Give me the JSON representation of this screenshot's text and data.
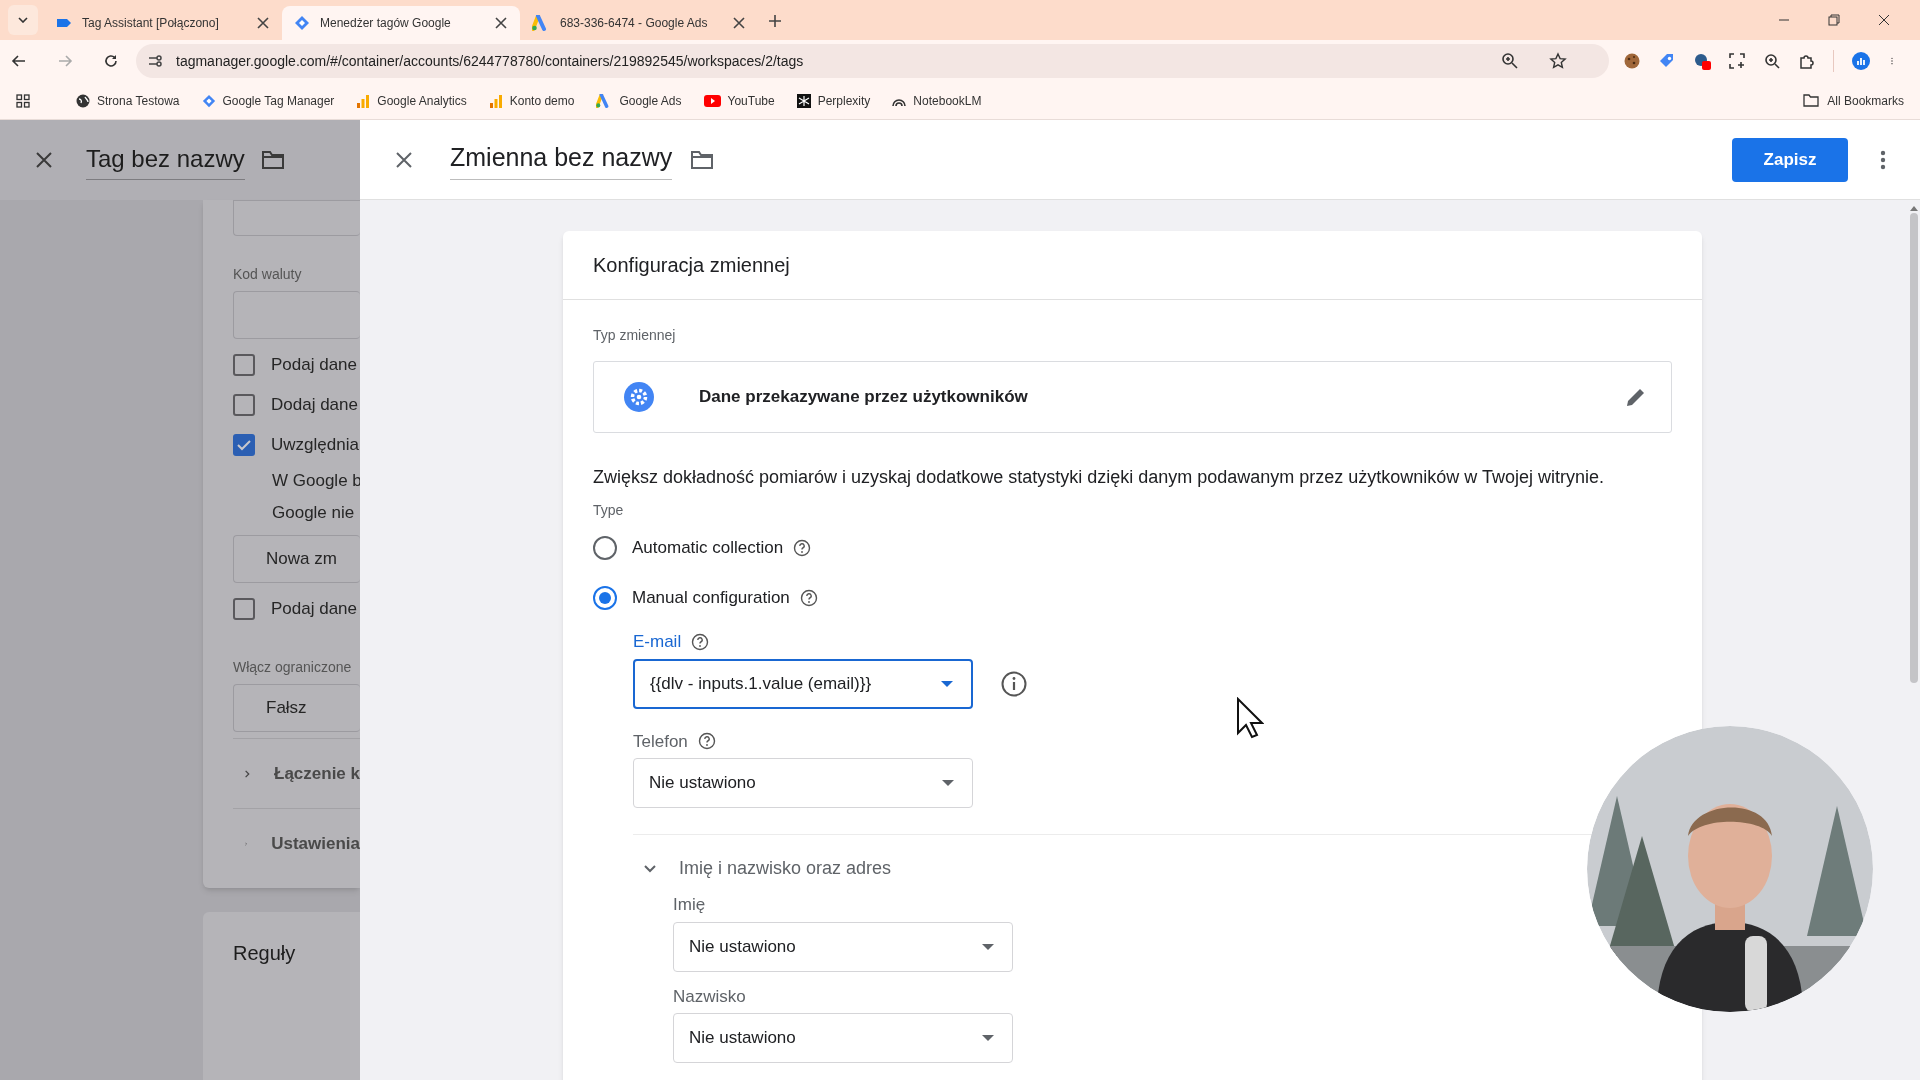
{
  "browser": {
    "tabs": [
      {
        "title": "Tag Assistant [Połączono]",
        "selected": false
      },
      {
        "title": "Menedżer tagów Google",
        "selected": true
      },
      {
        "title": "683-336-6474 - Google Ads",
        "selected": false
      }
    ],
    "url": "tagmanager.google.com/#/container/accounts/6244778780/containers/219892545/workspaces/2/tags",
    "bookmarks": [
      "Strona Testowa",
      "Google Tag Manager",
      "Google Analytics",
      "Konto demo",
      "Google Ads",
      "YouTube",
      "Perplexity",
      "NotebookLM"
    ],
    "all_bookmarks": "All Bookmarks"
  },
  "tag_editor": {
    "title": "Tag bez nazwy",
    "items": [
      {
        "kind": "input"
      },
      {
        "kind": "label",
        "text": "Kod waluty"
      },
      {
        "kind": "input"
      },
      {
        "kind": "checkbox",
        "label": "Podaj dane",
        "checked": false
      },
      {
        "kind": "checkbox",
        "label": "Dodaj dane",
        "checked": false
      },
      {
        "kind": "checkbox",
        "label": "Uwzględnia",
        "checked": true
      },
      {
        "kind": "text",
        "text": "W Google b"
      },
      {
        "kind": "text",
        "text": "Google nie"
      },
      {
        "kind": "input",
        "value": "Nowa zm"
      },
      {
        "kind": "checkbox",
        "label": "Podaj dane",
        "checked": false
      },
      {
        "kind": "label",
        "text": "Włącz ograniczone"
      },
      {
        "kind": "input",
        "value": "Fałsz"
      },
      {
        "kind": "section",
        "label": "Łączenie k"
      },
      {
        "kind": "section",
        "label": "Ustawienia"
      }
    ],
    "rules_title": "Reguły"
  },
  "variable_editor": {
    "title": "Zmienna bez nazwy",
    "save_button": "Zapisz",
    "card": {
      "heading": "Konfiguracja zmiennej",
      "type_label": "Typ zmiennej",
      "type_name": "Dane przekazywane przez użytkowników",
      "description": "Zwiększ dokładność pomiarów i uzyskaj dodatkowe statystyki dzięki danym podawanym przez użytkowników w Twojej witrynie.",
      "type_heading": "Type",
      "options": [
        {
          "label": "Automatic collection",
          "selected": false
        },
        {
          "label": "Manual configuration",
          "selected": true
        }
      ],
      "fields": [
        {
          "label": "E-mail",
          "value": "{{dlv - inputs.1.value (email)}}",
          "focused": true
        },
        {
          "label": "Telefon",
          "value": "Nie ustawiono",
          "focused": false
        }
      ],
      "section": {
        "label": "Imię i nazwisko oraz adres",
        "expanded": true,
        "fields": [
          {
            "label": "Imię",
            "value": "Nie ustawiono",
            "focused": false
          },
          {
            "label": "Nazwisko",
            "value": "Nie ustawiono",
            "focused": false
          }
        ]
      }
    }
  }
}
